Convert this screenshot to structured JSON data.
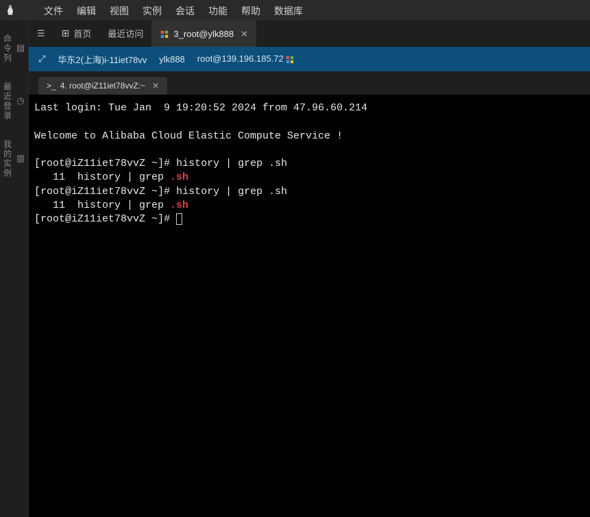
{
  "menu": {
    "file": "文件",
    "edit": "编辑",
    "view": "视图",
    "instance": "实例",
    "session": "会话",
    "function": "功能",
    "help": "帮助",
    "database": "数据库"
  },
  "left_rail": {
    "item1": "命令列",
    "item2": "最近登录",
    "item3": "我的实例"
  },
  "tabstrip": {
    "home": "首页",
    "recent": "最近访问",
    "active_tab": "3_root@ylk888"
  },
  "connection": {
    "region_instance": "华东2(上海)i-11iet78vv",
    "hostname": "ylk888",
    "userhost": "root@139.196.185.72"
  },
  "term_tab": {
    "label": "4. root@iZ11iet78vvZ:~"
  },
  "terminal": {
    "line1": "Last login: Tue Jan  9 19:20:52 2024 from 47.96.60.214",
    "blank": "",
    "line2": "Welcome to Alibaba Cloud Elastic Compute Service !",
    "prompt_open": "[",
    "prompt_user": "root@iZ11iet78vvZ",
    "prompt_path": " ~",
    "prompt_close": "]# ",
    "cmd1": "history | grep .sh",
    "out_num": "   11  ",
    "out_cmd": "history | grep ",
    "out_hl": ".sh",
    "cmd2": "history | grep .sh"
  }
}
